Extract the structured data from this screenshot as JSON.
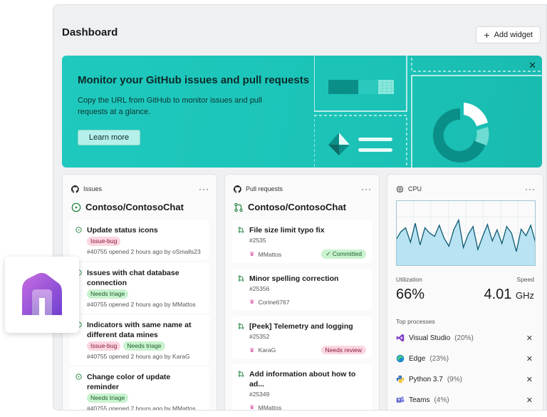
{
  "header": {
    "title": "Dashboard",
    "add_widget_label": "Add widget"
  },
  "banner": {
    "title": "Monitor your GitHub issues and pull requests",
    "text": "Copy the URL from GitHub to monitor issues and pull requests at a glance.",
    "button_label": "Learn more"
  },
  "issues": {
    "header": "Issues",
    "repo": "Contoso/ContosoChat",
    "items": [
      {
        "title": "Update status icons",
        "tags": [
          "Issue-bug"
        ],
        "meta": "#40755 opened 2 hours ago by oSmalls23"
      },
      {
        "title": "Issues with chat database connection",
        "tags": [
          "Needs triage"
        ],
        "meta": "#40755 opened 2 hours ago by MMattos"
      },
      {
        "title": "Indicators with same name at different data mines",
        "tags": [
          "Issue-bug",
          "Needs triage"
        ],
        "meta": "#40755 opened 2 hours ago by KaraG"
      },
      {
        "title": "Change color of update reminder",
        "tags": [
          "Needs triage"
        ],
        "meta": "#40755 opened 2 hours ago by MMattos"
      }
    ]
  },
  "pulls": {
    "header": "Pull requests",
    "repo": "Contoso/ContosoChat",
    "items": [
      {
        "title": "File size limit typo fix",
        "num": "#2535",
        "author": "MMattos",
        "status": "Committed"
      },
      {
        "title": "Minor spelling correction",
        "num": "#25356",
        "author": "Corine6767",
        "status": ""
      },
      {
        "title": "[Peek] Telemetry and logging",
        "num": "#25352",
        "author": "KaraG",
        "status": "Needs review"
      },
      {
        "title": "Add information about how to ad...",
        "num": "#25349",
        "author": "MMattos",
        "status": ""
      }
    ]
  },
  "cpu": {
    "header": "CPU",
    "utilization_label": "Utilization",
    "utilization_value": "66%",
    "speed_label": "Speed",
    "speed_value": "4.01",
    "speed_unit": "GHz",
    "top_label": "Top processes",
    "processes": [
      {
        "name": "Visual Studio",
        "pct": "(20%)"
      },
      {
        "name": "Edge",
        "pct": "(23%)"
      },
      {
        "name": "Python 3.7",
        "pct": "(9%)"
      },
      {
        "name": "Teams",
        "pct": "(4%)"
      }
    ],
    "chart_data": {
      "type": "area",
      "values": [
        40,
        52,
        58,
        36,
        65,
        32,
        58,
        50,
        45,
        62,
        42,
        30,
        55,
        70,
        28,
        48,
        60,
        25,
        45,
        63,
        38,
        55,
        34,
        60,
        50,
        22,
        56,
        46,
        62,
        35
      ]
    }
  },
  "colors": {
    "accent": "#1fc9bd",
    "chart_line": "#0e5a73",
    "chart_fill": "#b9e3f2"
  }
}
